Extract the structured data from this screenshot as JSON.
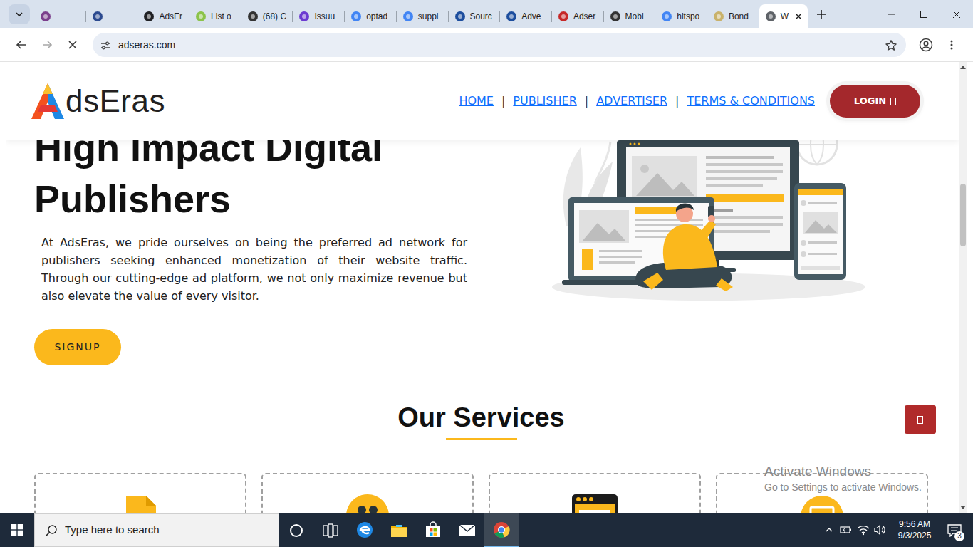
{
  "browser": {
    "tabs": [
      {
        "selected": false,
        "color": "#7b3f8c"
      },
      {
        "selected": false,
        "color": "#2c4a8f"
      },
      {
        "label": "AdsEr",
        "selected": false,
        "color": "#202124"
      },
      {
        "label": "List o",
        "selected": false,
        "color": "#8bc34a"
      },
      {
        "label": "(68) C",
        "selected": false,
        "color": "#333333"
      },
      {
        "label": "Issuu",
        "selected": false,
        "color": "#6c3bd1"
      },
      {
        "label": "optad",
        "selected": false,
        "color": "#4285f4"
      },
      {
        "label": "suppl",
        "selected": false,
        "color": "#4285f4"
      },
      {
        "label": "Sourc",
        "selected": false,
        "color": "#1d4e9e"
      },
      {
        "label": "Adve",
        "selected": false,
        "color": "#1d4e9e"
      },
      {
        "label": "Adser",
        "selected": false,
        "color": "#c62828"
      },
      {
        "label": "Mobi",
        "selected": false,
        "color": "#333333"
      },
      {
        "label": "hitspo",
        "selected": false,
        "color": "#4285f4"
      },
      {
        "label": "Bond",
        "selected": false,
        "color": "#c9b26b"
      },
      {
        "label": "W",
        "selected": true,
        "color": "#5f6368"
      }
    ],
    "address": "adseras.com",
    "loading": true,
    "scroll_position": 0.31
  },
  "site": {
    "logo_text": "dsEras",
    "nav": [
      "HOME",
      "PUBLISHER",
      "ADVERTISER",
      "TERMS & CONDITIONS"
    ],
    "nav_separator": "|",
    "login": "LOGIN",
    "hero": {
      "title_lines": [
        "High Impact Digital",
        "Publishers"
      ],
      "text": "At AdsEras, we pride ourselves on being the preferred ad network for publishers seeking enhanced monetization of their website traffic. Through our cutting-edge ad platform, we not only maximize revenue but also elevate the value of every visitor.",
      "button": "SIGNUP"
    },
    "services": {
      "heading": "Our Services",
      "cards": [
        {
          "kind": "document"
        },
        {
          "kind": "team"
        },
        {
          "kind": "browser"
        },
        {
          "kind": "monitor"
        }
      ]
    }
  },
  "watermark": {
    "title": "Activate Windows",
    "subtitle": "Go to Settings to activate Windows."
  },
  "taskbar": {
    "search": {
      "placeholder": "Type here to search"
    },
    "apps": [
      {
        "kind": "cortana",
        "selected": false
      },
      {
        "kind": "taskview",
        "selected": false
      },
      {
        "kind": "edge",
        "selected": false
      },
      {
        "kind": "explorer",
        "selected": false
      },
      {
        "kind": "store",
        "selected": false
      },
      {
        "kind": "mail",
        "selected": false
      },
      {
        "kind": "chrome",
        "selected": true
      }
    ],
    "time": "9:56 AM",
    "date": "9/3/2025",
    "notifications": "3"
  }
}
